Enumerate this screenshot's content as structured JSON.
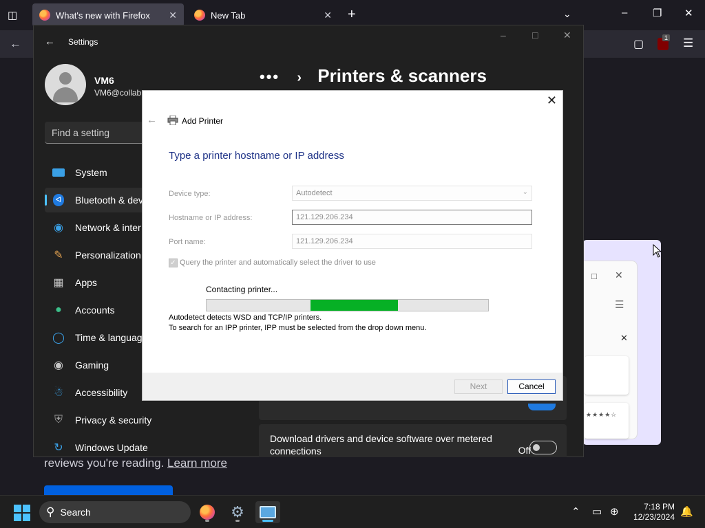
{
  "browser": {
    "tabs": [
      {
        "label": "What's new with Firefox",
        "active": true
      },
      {
        "label": "New Tab",
        "active": false
      }
    ],
    "notification_count": "1",
    "page_text": "reviews you're reading.",
    "page_link": "Learn more"
  },
  "settings": {
    "title": "Settings",
    "user": {
      "name": "VM6",
      "email": "VM6@collab"
    },
    "search_placeholder": "Find a setting",
    "breadcrumb": {
      "dots": "•••",
      "page": "Printers & scanners"
    },
    "nav": [
      {
        "label": "System",
        "icon": "system-icon"
      },
      {
        "label": "Bluetooth & devi",
        "icon": "bluetooth-icon",
        "active": true
      },
      {
        "label": "Network & inter",
        "icon": "network-icon"
      },
      {
        "label": "Personalization",
        "icon": "brush-icon"
      },
      {
        "label": "Apps",
        "icon": "apps-icon"
      },
      {
        "label": "Accounts",
        "icon": "accounts-icon"
      },
      {
        "label": "Time & languag",
        "icon": "globe-icon"
      },
      {
        "label": "Gaming",
        "icon": "gamepad-icon"
      },
      {
        "label": "Accessibility",
        "icon": "accessibility-icon"
      },
      {
        "label": "Privacy & security",
        "icon": "shield-icon"
      },
      {
        "label": "Windows Update",
        "icon": "update-icon"
      }
    ],
    "metered_card": {
      "text": "Download drivers and device software over metered connections",
      "toggle_label": "Off",
      "toggle_on": false
    }
  },
  "dialog": {
    "title": "Add Printer",
    "heading": "Type a printer hostname or IP address",
    "device_type": {
      "label": "Device type:",
      "value": "Autodetect"
    },
    "hostname": {
      "label": "Hostname or IP address:",
      "value": "121.129.206.234"
    },
    "port": {
      "label": "Port name:",
      "value": "121.129.206.234"
    },
    "query_checkbox": {
      "label": "Query the printer and automatically select the driver to use",
      "checked": true
    },
    "status": "Contacting printer...",
    "progress_segment": [
      0.37,
      0.68
    ],
    "info_line1": "Autodetect detects WSD and TCP/IP printers.",
    "info_line2": "To search for an IPP printer, IPP must be selected from the drop down menu.",
    "next_label": "Next",
    "cancel_label": "Cancel"
  },
  "taskbar": {
    "search_label": "Search",
    "time": "7:18 PM",
    "date": "12/23/2024"
  },
  "colors": {
    "accent_blue": "#4cc2ff",
    "progress_green": "#06b025",
    "dialog_heading": "#1e3287"
  }
}
